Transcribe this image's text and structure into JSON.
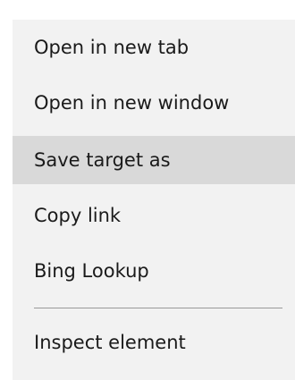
{
  "context_menu": {
    "items": [
      {
        "label": "Open in new tab"
      },
      {
        "label": "Open in new window"
      },
      {
        "label": "Save target as",
        "highlighted": true
      },
      {
        "label": "Copy link"
      },
      {
        "label": "Bing Lookup"
      }
    ],
    "footer_items": [
      {
        "label": "Inspect element"
      }
    ]
  },
  "colors": {
    "menu_background": "#f2f2f2",
    "highlight_background": "#d9d9d9",
    "text": "#1a1a1a",
    "separator": "#9a9a9a"
  }
}
